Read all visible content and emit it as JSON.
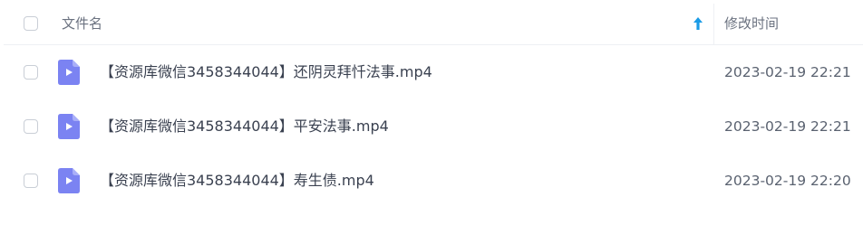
{
  "header": {
    "name_column": "文件名",
    "time_column": "修改时间",
    "sort_icon": "arrow-up-icon"
  },
  "files": [
    {
      "name": "【资源库微信3458344044】还阴灵拜忏法事.mp4",
      "modified": "2023-02-19 22:21",
      "icon": "video-file-icon"
    },
    {
      "name": "【资源库微信3458344044】平安法事.mp4",
      "modified": "2023-02-19 22:21",
      "icon": "video-file-icon"
    },
    {
      "name": "【资源库微信3458344044】寿生债.mp4",
      "modified": "2023-02-19 22:20",
      "icon": "video-file-icon"
    }
  ],
  "colors": {
    "accent": "#1a9be6",
    "file_icon": "#7b83f2",
    "divider": "#eef0f4"
  }
}
